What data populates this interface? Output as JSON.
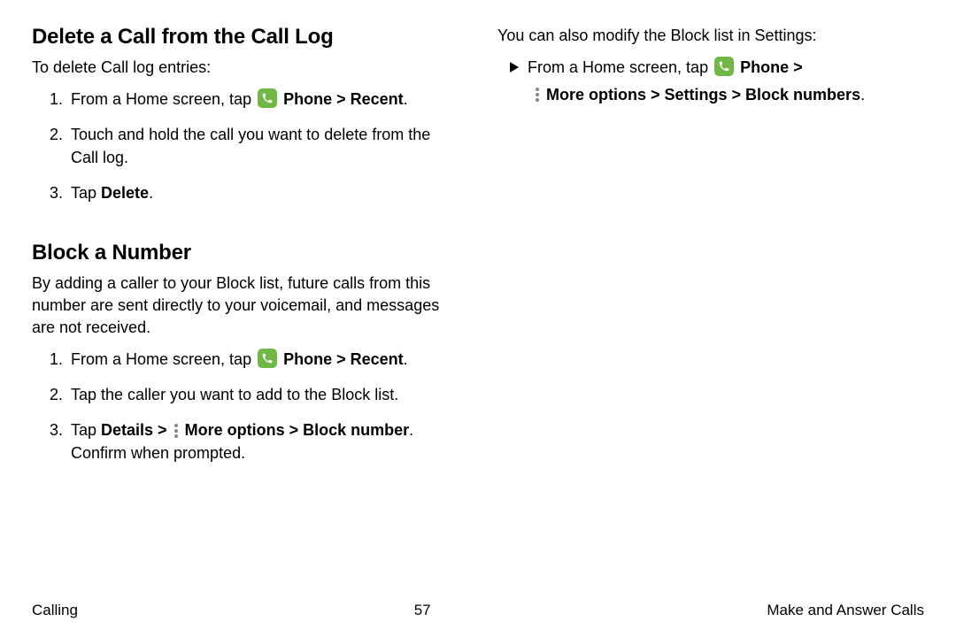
{
  "col1": {
    "h_delete": "Delete a Call from the Call Log",
    "p_delete": "To delete Call log entries:",
    "delete_steps": {
      "s1_pre": "From a Home screen, tap ",
      "s1_bold": "Phone > Recent",
      "s1_dot": ".",
      "s2": "Touch and hold the call you want to delete from the Call log.",
      "s3_pre": "Tap ",
      "s3_bold": "Delete",
      "s3_dot": "."
    },
    "h_block": "Block a Number",
    "p_block": "By adding a caller to your Block list, future calls from this number are sent directly to your voicemail, and messages are not received.",
    "block_steps": {
      "s1_pre": "From a Home screen, tap ",
      "s1_bold": "Phone > Recent",
      "s1_dot": ".",
      "s2": "Tap the caller you want to add to the Block list.",
      "s3_pre": "Tap ",
      "s3_bold1": "Details > ",
      "s3_bold2": "More options > Block number",
      "s3_post": ". Confirm when prompted."
    }
  },
  "col2": {
    "p_settings": "You can also modify the Block list in Settings:",
    "line1_pre": "From a Home screen, tap ",
    "line1_bold": "Phone >",
    "line2_bold": "More options > Settings > Block numbers",
    "line2_dot": "."
  },
  "footer": {
    "left": "Calling",
    "center": "57",
    "right": "Make and Answer Calls"
  },
  "icons": {
    "phone": "phone-icon",
    "more": "more-options-icon",
    "arrow": "list-arrow"
  }
}
